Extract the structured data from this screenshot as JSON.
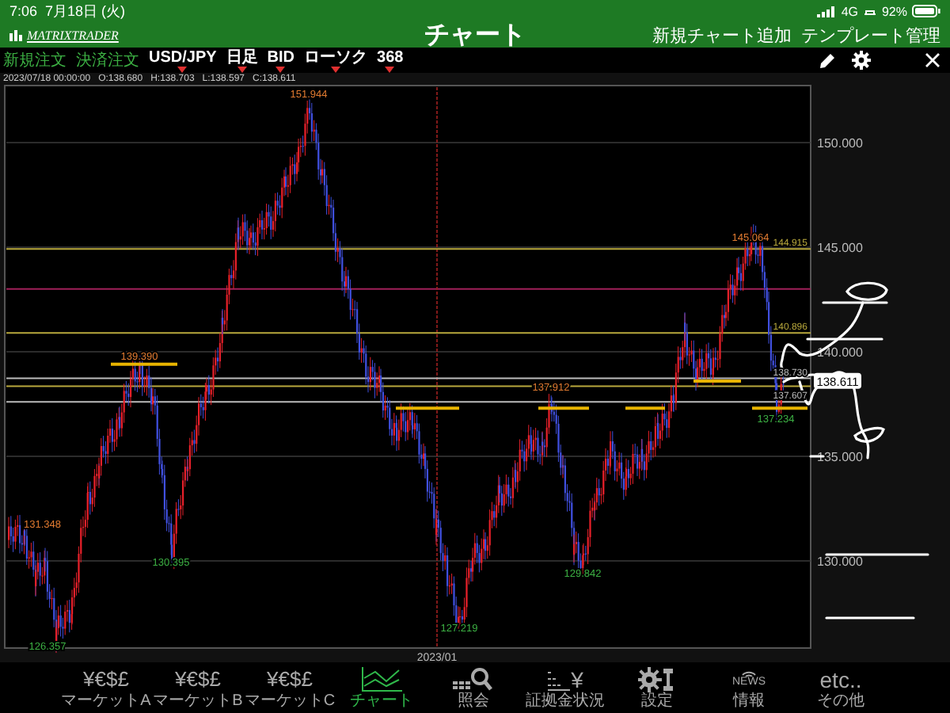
{
  "status_bar": {
    "time": "7:06",
    "date": "7月18日 (火)",
    "network": "4G",
    "battery": "92%"
  },
  "header": {
    "logo": "MATRIXTRADER",
    "title": "チャート",
    "actions": [
      "新規チャート追加",
      "テンプレート管理"
    ]
  },
  "toolbar": {
    "order_buttons": [
      "新規注文",
      "決済注文"
    ],
    "selectors": [
      {
        "label": "USD/JPY"
      },
      {
        "label": "日足"
      },
      {
        "label": "BID"
      },
      {
        "label": "ローソク"
      },
      {
        "label": "368"
      }
    ]
  },
  "ohlc": [
    "2023/07/18 00:00:00",
    "O:138.680",
    "H:138.703",
    "L:138.597",
    "C:138.611"
  ],
  "chart": {
    "y_ticks": [
      "150.000",
      "145.000",
      "140.000",
      "135.000",
      "130.000"
    ],
    "current_price": "138.611",
    "x_label": "2023/01",
    "levels": [
      {
        "label": "144.915",
        "color": "#b8a83c"
      },
      {
        "label": "140.896",
        "color": "#b8a83c"
      },
      {
        "label": "138.730",
        "color": "#bbbbbb"
      },
      {
        "label": "137.607",
        "color": "#bbbbbb"
      }
    ],
    "markers": [
      {
        "label": "151.944",
        "kind": "high"
      },
      {
        "label": "139.390",
        "kind": "high"
      },
      {
        "label": "131.348",
        "kind": "high"
      },
      {
        "label": "126.357",
        "kind": "low"
      },
      {
        "label": "130.395",
        "kind": "low"
      },
      {
        "label": "127.219",
        "kind": "low"
      },
      {
        "label": "137.912",
        "kind": "high"
      },
      {
        "label": "129.842",
        "kind": "low"
      },
      {
        "label": "145.064",
        "kind": "high"
      },
      {
        "label": "137.234",
        "kind": "low"
      }
    ]
  },
  "tabs": [
    {
      "label": "マーケットA",
      "kind": "currency",
      "icon_text": "¥€$£",
      "selected": false
    },
    {
      "label": "マーケットB",
      "kind": "currency",
      "icon_text": "¥€$£",
      "selected": false
    },
    {
      "label": "マーケットC",
      "kind": "currency",
      "icon_text": "¥€$£",
      "selected": false
    },
    {
      "label": "チャート",
      "kind": "chart",
      "selected": true
    },
    {
      "label": "照会",
      "kind": "search",
      "selected": false
    },
    {
      "label": "証拠金状況",
      "kind": "margin",
      "icon_text": "¥",
      "selected": false
    },
    {
      "label": "設定",
      "kind": "settings",
      "selected": false
    },
    {
      "label": "情報",
      "kind": "news",
      "icon_text": "NEWS",
      "selected": false
    },
    {
      "label": "その他",
      "kind": "text",
      "icon_text": "etc..",
      "selected": false
    }
  ]
}
